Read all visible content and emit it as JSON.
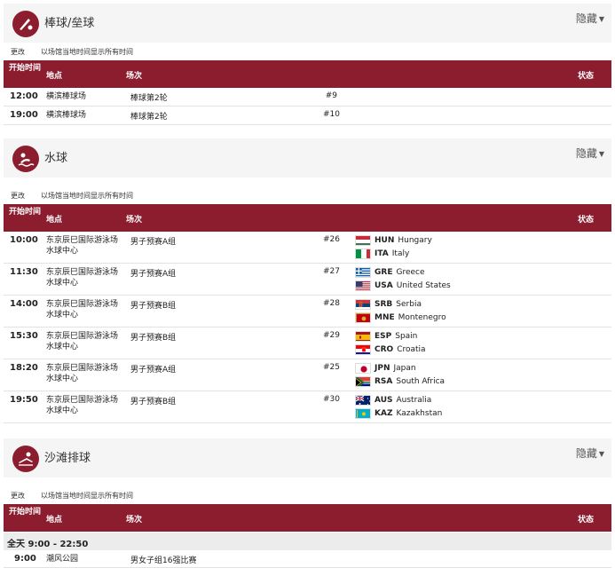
{
  "common": {
    "hide_label": "隐藏",
    "change_label": "更改",
    "note_label": "以场馆当地时间显示所有时间",
    "col_time": "开始时间",
    "col_venue": "地点",
    "col_event": "场次",
    "col_status": "状态"
  },
  "baseball": {
    "name": "棒球/垒球",
    "rows": [
      {
        "time": "12:00",
        "venue": "横滨棒球场",
        "event": "棒球第2轮",
        "num": "#9"
      },
      {
        "time": "19:00",
        "venue": "横滨棒球场",
        "event": "棒球第2轮",
        "num": "#10"
      }
    ]
  },
  "waterpolo": {
    "name": "水球",
    "rows": [
      {
        "time": "10:00",
        "venue": "东京辰巳国际游泳场水球中心",
        "event": "男子预赛A组",
        "num": "#26",
        "team1": {
          "code": "HUN",
          "name": "Hungary",
          "flag": "hun-flag"
        },
        "team2": {
          "code": "ITA",
          "name": "Italy",
          "flag": "ita-flag"
        }
      },
      {
        "time": "11:30",
        "venue": "东京辰巳国际游泳场水球中心",
        "event": "男子预赛A组",
        "num": "#27",
        "team1": {
          "code": "GRE",
          "name": "Greece",
          "flag": "gre-flag"
        },
        "team2": {
          "code": "USA",
          "name": "United States",
          "flag": "usa-flag"
        }
      },
      {
        "time": "14:00",
        "venue": "东京辰巳国际游泳场水球中心",
        "event": "男子预赛B组",
        "num": "#28",
        "team1": {
          "code": "SRB",
          "name": "Serbia",
          "flag": "srb-flag"
        },
        "team2": {
          "code": "MNE",
          "name": "Montenegro",
          "flag": "mne-flag"
        }
      },
      {
        "time": "15:30",
        "venue": "东京辰巳国际游泳场水球中心",
        "event": "男子预赛B组",
        "num": "#29",
        "team1": {
          "code": "ESP",
          "name": "Spain",
          "flag": "esp-flag"
        },
        "team2": {
          "code": "CRO",
          "name": "Croatia",
          "flag": "cro-flag"
        }
      },
      {
        "time": "18:20",
        "venue": "东京辰巳国际游泳场水球中心",
        "event": "男子预赛A组",
        "num": "#25",
        "team1": {
          "code": "JPN",
          "name": "Japan",
          "flag": "jpn-flag"
        },
        "team2": {
          "code": "RSA",
          "name": "South Africa",
          "flag": "rsa-flag"
        }
      },
      {
        "time": "19:50",
        "venue": "东京辰巳国际游泳场水球中心",
        "event": "男子预赛B组",
        "num": "#30",
        "team1": {
          "code": "AUS",
          "name": "Australia",
          "flag": "aus-flag"
        },
        "team2": {
          "code": "KAZ",
          "name": "Kazakhstan",
          "flag": "kaz-flag"
        }
      }
    ]
  },
  "beachvolleyball": {
    "name": "沙滩排球",
    "allday": "全天  9:00 - 22:50",
    "rows": [
      {
        "time": "9:00",
        "venue": "潮风公园",
        "event": "男女子组16强比赛"
      }
    ]
  },
  "colors": {
    "brand": "#8c1d2f",
    "header_bg": "#f5f5f5"
  }
}
